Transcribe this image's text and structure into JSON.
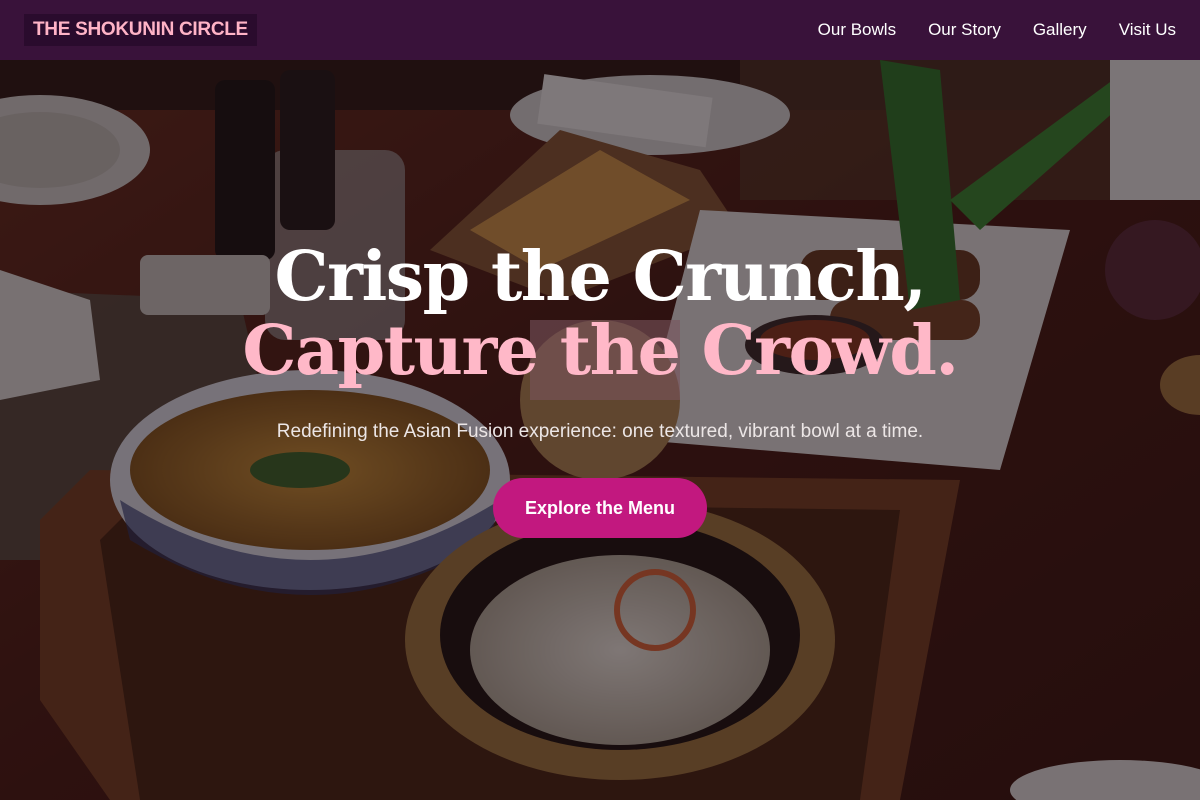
{
  "nav": {
    "brand": "THE SHOKUNIN CIRCLE",
    "links": [
      "Our Bowls",
      "Our Story",
      "Gallery",
      "Visit Us"
    ]
  },
  "hero": {
    "headline_line1": "Crisp the Crunch,",
    "headline_line2": "Capture the Crowd.",
    "subtitle": "Redefining the Asian Fusion experience: one textured, vibrant bowl at a time.",
    "cta_label": "Explore the Menu",
    "background_description_icon": "food-table-photo"
  },
  "colors": {
    "nav_bg": "#3c123e",
    "brand_text": "#ffb3c6",
    "headline_accent": "#ffb8c8",
    "cta_bg": "#c2187f"
  }
}
